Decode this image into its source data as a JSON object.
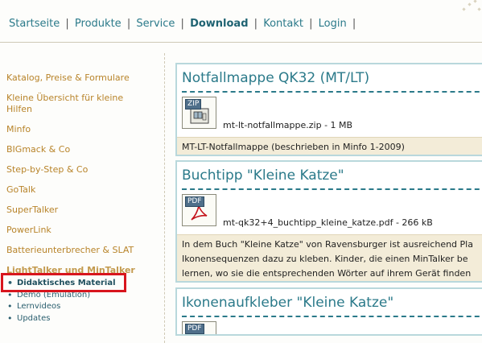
{
  "nav": {
    "items": [
      "Startseite",
      "Produkte",
      "Service",
      "Download",
      "Kontakt",
      "Login"
    ],
    "separator": "|",
    "active": "Download"
  },
  "sidebar": {
    "items": [
      "Katalog, Preise & Formulare",
      "Kleine Übersicht für kleine Hilfen",
      "Minfo",
      "BIGmack & Co",
      "Step-by-Step & Co",
      "GoTalk",
      "SuperTalker",
      "PowerLink",
      "Batterieunterbrecher & SLAT",
      "LightTalker und MinTalker"
    ],
    "subitems": [
      "Didaktisches Material",
      "Demo (Emulation)",
      "Lernvideos",
      "Updates"
    ]
  },
  "downloads": [
    {
      "title": "Notfallmappe QK32 (MT/LT)",
      "icon_label": "ZIP",
      "file": "mt-lt-notfallmappe.zip - 1 MB",
      "desc1": "MT-LT-Notfallmappe (beschrieben in Minfo 1-2009)",
      "desc2": "",
      "desc3": ""
    },
    {
      "title": "Buchtipp \"Kleine Katze\"",
      "icon_label": "PDF",
      "file": "mt-qk32+4_buchtipp_kleine_katze.pdf - 266 kB",
      "desc1": "In dem Buch \"Kleine Katze\" von Ravensburger ist ausreichend Pla",
      "desc2": "Ikonensequenzen dazu zu kleben. Kinder, die einen MinTalker be",
      "desc3": "lernen, wo sie die entsprechenden Wörter auf ihrem Gerät finden"
    },
    {
      "title": "Ikonenaufkleber \"Kleine Katze\"",
      "icon_label": "PDF",
      "file": "",
      "desc1": "",
      "desc2": "",
      "desc3": ""
    }
  ],
  "colors": {
    "accent": "#2b7a8a",
    "sidebar_link": "#b8842a",
    "highlight": "#d8151d",
    "box_border": "#b9d8dc",
    "desc_bg": "#f3ecd8"
  }
}
